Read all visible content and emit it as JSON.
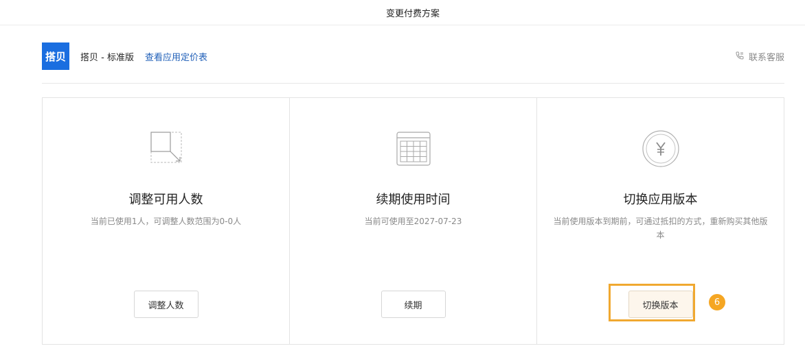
{
  "header": {
    "title": "变更付费方案"
  },
  "app": {
    "logo_text": "搭贝",
    "name": "搭贝 - 标准版",
    "pricing_link": "查看应用定价表",
    "contact_label": "联系客服",
    "contact_icon": "phone-icon",
    "accent": "#1a6ee0",
    "link_color": "#1f5fb8"
  },
  "cards": [
    {
      "icon": "resize-icon",
      "title": "调整可用人数",
      "description": "当前已使用1人，可调整人数范围为0-0人",
      "button": "调整人数"
    },
    {
      "icon": "calendar-table-icon",
      "title": "续期使用时间",
      "description": "当前可使用至2027-07-23",
      "button": "续期"
    },
    {
      "icon": "yen-icon",
      "title": "切换应用版本",
      "description": "当前使用版本到期前，可通过抵扣的方式，重新购买其他版本",
      "button": "切换版本",
      "step_badge": "6",
      "highlight_color": "#f0a830"
    }
  ]
}
